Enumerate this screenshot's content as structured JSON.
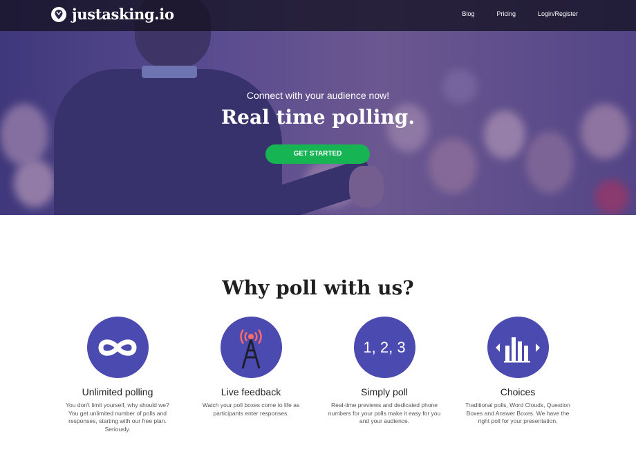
{
  "brand": {
    "name": "justasking.io",
    "icon": "poll-marker-icon"
  },
  "nav": {
    "blog": "Blog",
    "pricing": "Pricing",
    "login": "Login/Register"
  },
  "hero": {
    "subtitle": "Connect with your audience now!",
    "title": "Real time polling.",
    "cta_label": "GET STARTED"
  },
  "features": {
    "title": "Why poll with us?",
    "items": [
      {
        "icon": "infinity-icon",
        "title": "Unlimited polling",
        "desc": "You don't limit yourself, why should we? You get unlimited number of polls and responses, starting with our free plan. Seriously."
      },
      {
        "icon": "broadcast-tower-icon",
        "title": "Live feedback",
        "desc": "Watch your poll boxes come to life as participants enter responses."
      },
      {
        "icon": "numbers-icon",
        "icon_text": "1, 2, 3",
        "title": "Simply poll",
        "desc": "Real-time previews and dedicated phone numbers for your polls make it easy for you and your audience."
      },
      {
        "icon": "bar-chart-choices-icon",
        "title": "Choices",
        "desc": "Traditional polls, Word Clouds, Question Boxes and Answer Boxes. We have the right poll for your presentation."
      }
    ]
  },
  "colors": {
    "accent": "#4a4ab0",
    "cta": "#17b454",
    "nav_bg": "#14122380"
  }
}
